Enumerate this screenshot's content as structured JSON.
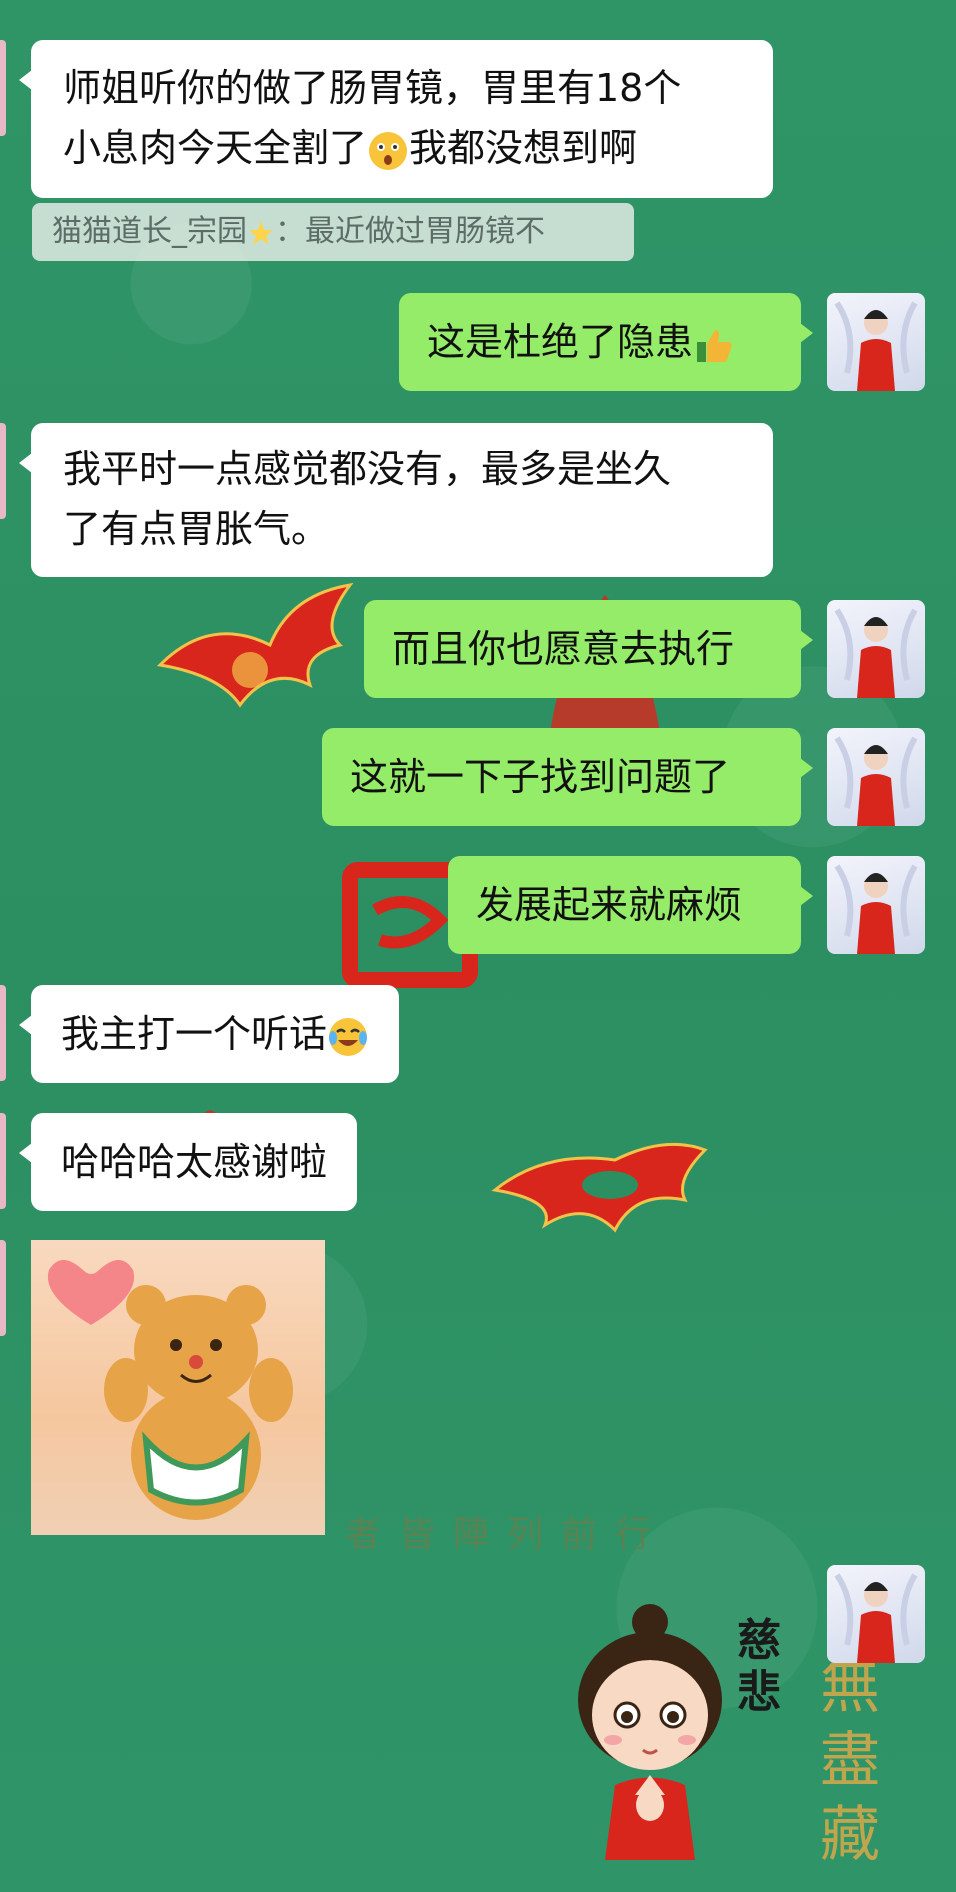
{
  "messages": [
    {
      "side": "in",
      "lines": [
        "师姐听你的做了肠胃镜，胃里有18个",
        "小息肉今天全割了",
        "我都没想到啊"
      ],
      "emoji": "astonished-face"
    },
    {
      "quote": "猫猫道长_宗园",
      "quote_sep": "：",
      "quote_text": "最近做过胃肠镜不"
    },
    {
      "side": "out",
      "text": "这是杜绝了隐患",
      "emoji": "thumbs-up"
    },
    {
      "side": "in",
      "lines": [
        "我平时一点感觉都没有，最多是坐久",
        "了有点胃胀气。"
      ]
    },
    {
      "side": "out",
      "text": "而且你也愿意去执行"
    },
    {
      "side": "out",
      "text": "这就一下子找到问题了"
    },
    {
      "side": "out",
      "text": "发展起来就麻烦"
    },
    {
      "side": "in",
      "text": "我主打一个听话",
      "emoji": "crying-laughing-face"
    },
    {
      "side": "in",
      "text": "哈哈哈太感谢啦"
    },
    {
      "side": "in",
      "sticker": "teddy-bear-heart"
    },
    {
      "side": "out",
      "sticker": "cartoon-girl-cibei",
      "sticker_text": "慈悲"
    }
  ],
  "background_text": {
    "motto": "者皆陣列前行",
    "side_chars": "無盡藏"
  },
  "colors": {
    "background": "#2e9466",
    "outgoing_bubble": "#95ec69",
    "incoming_bubble": "#ffffff",
    "quote_bg": "#dce8e0",
    "decor_red": "#d8261c"
  }
}
